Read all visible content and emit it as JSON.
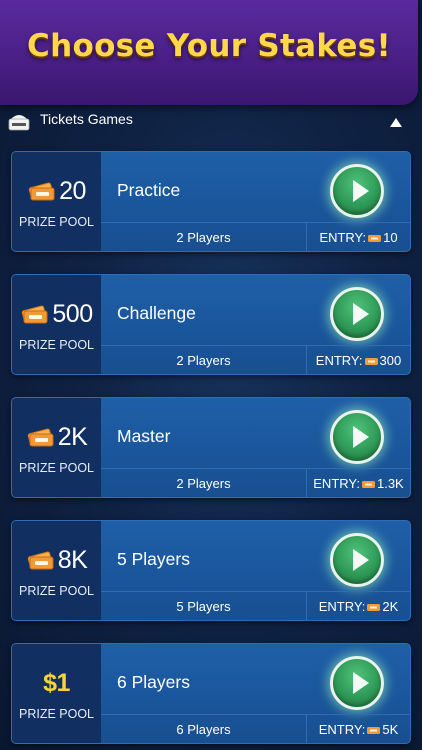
{
  "banner": {
    "title": "Choose Your Stakes!"
  },
  "section": {
    "title": "Tickets Games",
    "icon": "ticket-badge-icon"
  },
  "colors": {
    "banner": "#4a1f86",
    "title_gold": "#ffd84a",
    "card": "#1a559a",
    "prize_panel": "#122f62",
    "play_green": "#2f9a58",
    "ticket_orange": "#f29a3a"
  },
  "cards": [
    {
      "prize": "20",
      "prize_label": "PRIZE POOL",
      "title": "Practice",
      "players": "2 Players",
      "entry_label": "ENTRY:",
      "entry_value": "10"
    },
    {
      "prize": "500",
      "prize_label": "PRIZE POOL",
      "title": "Challenge",
      "players": "2 Players",
      "entry_label": "ENTRY:",
      "entry_value": "300"
    },
    {
      "prize": "2K",
      "prize_label": "PRIZE POOL",
      "title": "Master",
      "players": "2 Players",
      "entry_label": "ENTRY:",
      "entry_value": "1.3K"
    },
    {
      "prize": "8K",
      "prize_label": "PRIZE POOL",
      "title": "5 Players",
      "players": "5 Players",
      "entry_label": "ENTRY:",
      "entry_value": "2K"
    },
    {
      "prize": "$1",
      "prize_label": "PRIZE POOL",
      "title": "6 Players",
      "players": "6 Players",
      "entry_label": "ENTRY:",
      "entry_value": "5K"
    }
  ]
}
